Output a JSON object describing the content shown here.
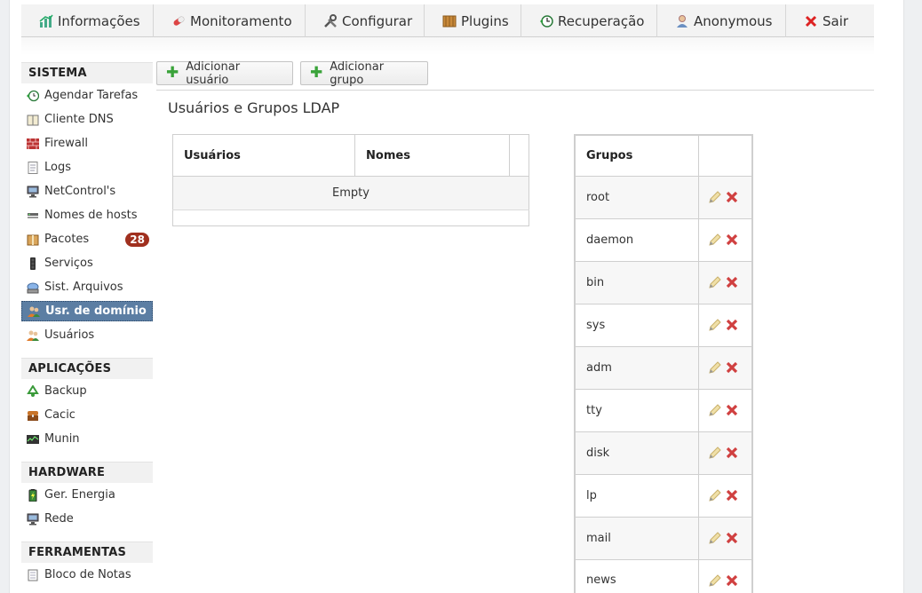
{
  "topmenu": [
    {
      "label": "Informações",
      "icon": "chart-icon"
    },
    {
      "label": "Monitoramento",
      "icon": "pill-icon"
    },
    {
      "label": "Configurar",
      "icon": "tools-icon"
    },
    {
      "label": "Plugins",
      "icon": "plugin-box-icon"
    },
    {
      "label": "Recuperação",
      "icon": "restore-clock-icon"
    },
    {
      "label": "Anonymous",
      "icon": "user-icon"
    },
    {
      "label": "Sair",
      "icon": "close-x-icon"
    }
  ],
  "sidebar": {
    "sistema": {
      "header": "SISTEMA",
      "items": [
        {
          "label": "Agendar Tarefas",
          "icon": "clock-icon"
        },
        {
          "label": "Cliente DNS",
          "icon": "book-icon"
        },
        {
          "label": "Firewall",
          "icon": "brick-wall-icon"
        },
        {
          "label": "Logs",
          "icon": "document-icon"
        },
        {
          "label": "NetControl's",
          "icon": "computer-icon"
        },
        {
          "label": "Nomes de hosts",
          "icon": "network-icon"
        },
        {
          "label": "Pacotes",
          "icon": "package-icon",
          "badge": "28"
        },
        {
          "label": "Serviços",
          "icon": "traffic-light-icon"
        },
        {
          "label": "Sist. Arquivos",
          "icon": "drive-icon"
        },
        {
          "label": "Usr. de domínio",
          "icon": "users-icon",
          "active": true
        },
        {
          "label": "Usuários",
          "icon": "users-icon"
        }
      ]
    },
    "aplicacoes": {
      "header": "APLICAÇÕES",
      "items": [
        {
          "label": "Backup",
          "icon": "recycle-icon"
        },
        {
          "label": "Cacic",
          "icon": "chest-icon"
        },
        {
          "label": "Munin",
          "icon": "monitor-graph-icon"
        }
      ]
    },
    "hardware": {
      "header": "HARDWARE",
      "items": [
        {
          "label": "Ger. Energia",
          "icon": "battery-icon"
        },
        {
          "label": "Rede",
          "icon": "computer-icon"
        }
      ]
    },
    "ferramentas": {
      "header": "FERRAMENTAS",
      "items": [
        {
          "label": "Bloco de Notas",
          "icon": "notepad-icon"
        }
      ]
    }
  },
  "buttons": {
    "add_user": "Adicionar usuário",
    "add_group": "Adicionar grupo"
  },
  "content": {
    "title": "Usuários e Grupos LDAP"
  },
  "users_table": {
    "headers": [
      "Usuários",
      "Nomes"
    ],
    "empty_text": "Empty"
  },
  "groups_table": {
    "header": "Grupos",
    "rows": [
      "root",
      "daemon",
      "bin",
      "sys",
      "adm",
      "tty",
      "disk",
      "lp",
      "mail",
      "news"
    ]
  },
  "colors": {
    "accent": "#5c7ea3",
    "badge": "#a0301f",
    "add_icon": "#3aa33a",
    "delete_icon": "#d04040"
  }
}
